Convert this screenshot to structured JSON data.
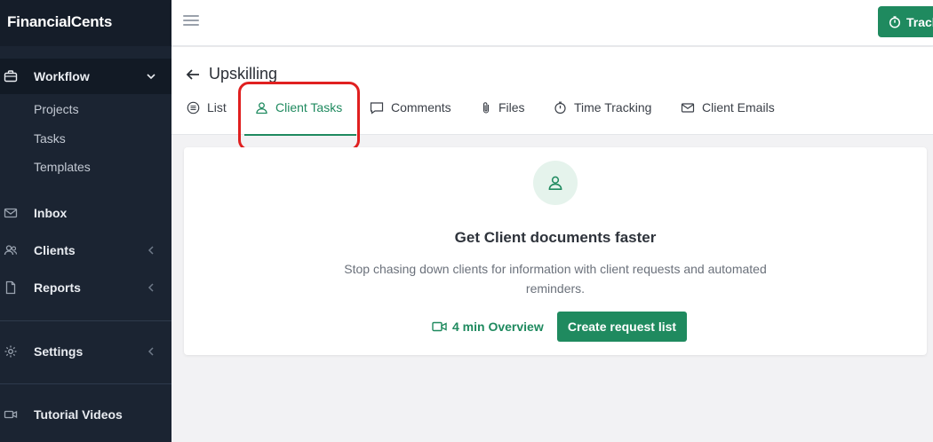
{
  "app": {
    "brand": "FinancialCents"
  },
  "sidebar": {
    "workflow": "Workflow",
    "sub_items": [
      "Projects",
      "Tasks",
      "Templates"
    ],
    "inbox": "Inbox",
    "clients": "Clients",
    "reports": "Reports",
    "settings": "Settings",
    "tutorial_videos": "Tutorial Videos"
  },
  "topbar": {
    "track_label": "Track"
  },
  "header": {
    "title": "Upskilling",
    "tabs": [
      {
        "label": "List",
        "icon": "list-icon"
      },
      {
        "label": "Client Tasks",
        "icon": "user-icon",
        "active": true
      },
      {
        "label": "Comments",
        "icon": "comment-icon"
      },
      {
        "label": "Files",
        "icon": "paperclip-icon"
      },
      {
        "label": "Time Tracking",
        "icon": "stopwatch-icon"
      },
      {
        "label": "Client Emails",
        "icon": "mail-icon"
      }
    ]
  },
  "empty_state": {
    "title": "Get Client documents faster",
    "description": "Stop chasing down clients for information with client requests and automated reminders.",
    "overview_link": "4 min Overview",
    "create_button": "Create request list"
  },
  "colors": {
    "accent": "#1f8a5f",
    "sidebar_bg": "#1b2432",
    "highlight": "#e02020"
  }
}
